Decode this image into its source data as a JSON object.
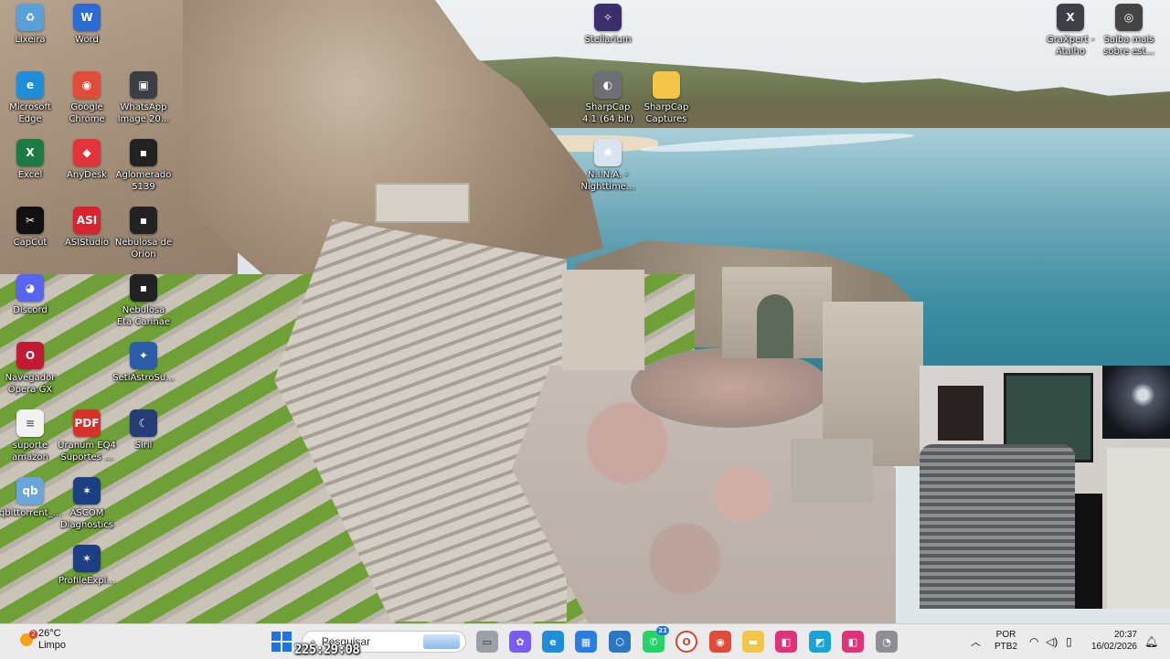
{
  "desktop": {
    "icons": [
      {
        "label": "Lixeira",
        "icon": "recycle-bin-icon",
        "color": "#5aa0d8",
        "glyph": "♻"
      },
      {
        "label": "Word",
        "icon": "word-icon",
        "color": "#2b6cd4",
        "glyph": "W"
      },
      {
        "label": "Microsoft Edge",
        "icon": "edge-icon",
        "color": "#1f8ed8",
        "glyph": "e"
      },
      {
        "label": "Google Chrome",
        "icon": "chrome-icon",
        "color": "#e04b3a",
        "glyph": "◉"
      },
      {
        "label": "WhatsApp Image 20...",
        "icon": "image-file-icon",
        "color": "#3b3f45",
        "glyph": "▣"
      },
      {
        "label": "Excel",
        "icon": "excel-icon",
        "color": "#1d7a44",
        "glyph": "X"
      },
      {
        "label": "AnyDesk",
        "icon": "anydesk-icon",
        "color": "#e2343a",
        "glyph": "◆"
      },
      {
        "label": "Aglomerado 5139",
        "icon": "image-file-icon",
        "color": "#222",
        "glyph": "▪"
      },
      {
        "label": "CapCut",
        "icon": "capcut-icon",
        "color": "#111",
        "glyph": "✂"
      },
      {
        "label": "ASIStudio",
        "icon": "asistudio-icon",
        "color": "#d9232e",
        "glyph": "ASI"
      },
      {
        "label": "Nebulosa de Órion",
        "icon": "image-file-icon",
        "color": "#222",
        "glyph": "▪"
      },
      {
        "label": "Discord",
        "icon": "discord-icon",
        "color": "#5865f2",
        "glyph": "◕"
      },
      {
        "label": "Nebulosa Eta Carinae",
        "icon": "image-file-icon",
        "color": "#222",
        "glyph": "▪"
      },
      {
        "label": "Navegador Opera GX",
        "icon": "opera-gx-icon",
        "color": "#c21a35",
        "glyph": "O"
      },
      {
        "label": "SetiAstroSu...",
        "icon": "setiastro-icon",
        "color": "#2c5ca8",
        "glyph": "✦"
      },
      {
        "label": "suporte amazon",
        "icon": "text-file-icon",
        "color": "#f2f2f2",
        "glyph": "≡"
      },
      {
        "label": "Uranum EQ4 Suportes ...",
        "icon": "pdf-icon",
        "color": "#d8312a",
        "glyph": "PDF"
      },
      {
        "label": "Siril",
        "icon": "siril-icon",
        "color": "#263c77",
        "glyph": "☾"
      },
      {
        "label": "qbittorrent_...",
        "icon": "qbittorrent-icon",
        "color": "#6aa6d9",
        "glyph": "qb"
      },
      {
        "label": "ASCOM Diagnostics",
        "icon": "ascom-icon",
        "color": "#1b3f82",
        "glyph": "✶"
      },
      {
        "label": "ProfileExpl...",
        "icon": "ascom-icon",
        "color": "#1b3f82",
        "glyph": "✶"
      },
      {
        "label": "Stellarium",
        "icon": "stellarium-icon",
        "color": "#3a2e6b",
        "glyph": "✧"
      },
      {
        "label": "SharpCap 4.1 (64 bit)",
        "icon": "sharpcap-icon",
        "color": "#6d6f75",
        "glyph": "◐"
      },
      {
        "label": "SharpCap Captures",
        "icon": "folder-icon",
        "color": "#f3c64a",
        "glyph": ""
      },
      {
        "label": "N.I.N.A. - Nighttime...",
        "icon": "nina-icon",
        "color": "#d7e3ef",
        "glyph": "✺"
      },
      {
        "label": "GraXpert - Atalho",
        "icon": "graxpert-icon",
        "color": "#3d4047",
        "glyph": "X"
      },
      {
        "label": "Saiba mais sobre est...",
        "icon": "spotlight-icon",
        "color": "#444",
        "glyph": "◎"
      }
    ]
  },
  "taskbar": {
    "weather": {
      "temp": "26°C",
      "condition": "Limpo",
      "badge": "2"
    },
    "search_placeholder": "Pesquisar",
    "timer_overlay": "225:29:08",
    "apps": [
      {
        "name": "task-view",
        "color": "#9aa0a6",
        "glyph": "▭"
      },
      {
        "name": "copilot",
        "color": "#7a5cf0",
        "glyph": "✿"
      },
      {
        "name": "edge",
        "color": "#1f8ed8",
        "glyph": "e"
      },
      {
        "name": "store",
        "color": "#2a7de1",
        "glyph": "▦"
      },
      {
        "name": "vpn",
        "color": "#2b78c2",
        "glyph": "⬡"
      },
      {
        "name": "whatsapp",
        "color": "#25d366",
        "glyph": "✆",
        "badge": "21"
      },
      {
        "name": "opera-gx",
        "color": "#ffffff",
        "glyph": "O"
      },
      {
        "name": "chrome",
        "color": "#e04b3a",
        "glyph": "◉"
      },
      {
        "name": "file-explorer",
        "color": "#f3c64a",
        "glyph": "▬"
      },
      {
        "name": "app-pink-1",
        "color": "#e0327a",
        "glyph": "◧"
      },
      {
        "name": "app-blue",
        "color": "#1ca3d6",
        "glyph": "◩"
      },
      {
        "name": "app-pink-2",
        "color": "#e0327a",
        "glyph": "◧"
      },
      {
        "name": "app-gray",
        "color": "#8d8f94",
        "glyph": "◔"
      }
    ],
    "language": {
      "line1": "POR",
      "line2": "PTB2"
    },
    "clock": {
      "time": "20:37",
      "date": "16/02/2026"
    }
  },
  "colors": {
    "taskbar_bg": "#ecebec",
    "accent": "#1e74e6"
  }
}
